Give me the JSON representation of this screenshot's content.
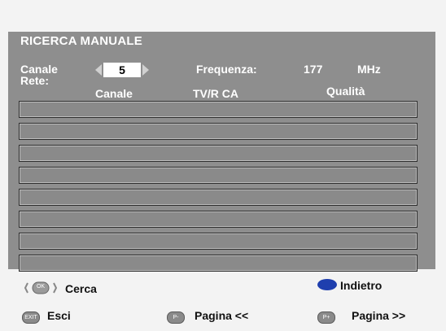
{
  "menu": {
    "title": "RICERCA MANUALE",
    "canale_label": "Canale",
    "rete_label": "Rete:",
    "channel_value": "5",
    "frequenza_label": "Frequenza:",
    "frequenza_value": "177",
    "frequenza_unit": "MHz"
  },
  "table": {
    "headers": [
      "Canale",
      "TV/R CA",
      "Qualità"
    ],
    "rows": [
      "",
      "",
      "",
      "",
      "",
      "",
      "",
      ""
    ]
  },
  "footer": {
    "search_label": "Cerca",
    "back_label": "Indietro",
    "exit_label": "Esci",
    "page_prev_label": "Pagina <<",
    "page_next_label": "Pagina >>",
    "ok_button_glyph": "OK",
    "exit_button_glyph": "EXIT",
    "page_prev_glyph": "P-",
    "page_next_glyph": "P+"
  },
  "colors": {
    "panel_bg": "#8e8e8e",
    "blue_button": "#1f3fae"
  }
}
